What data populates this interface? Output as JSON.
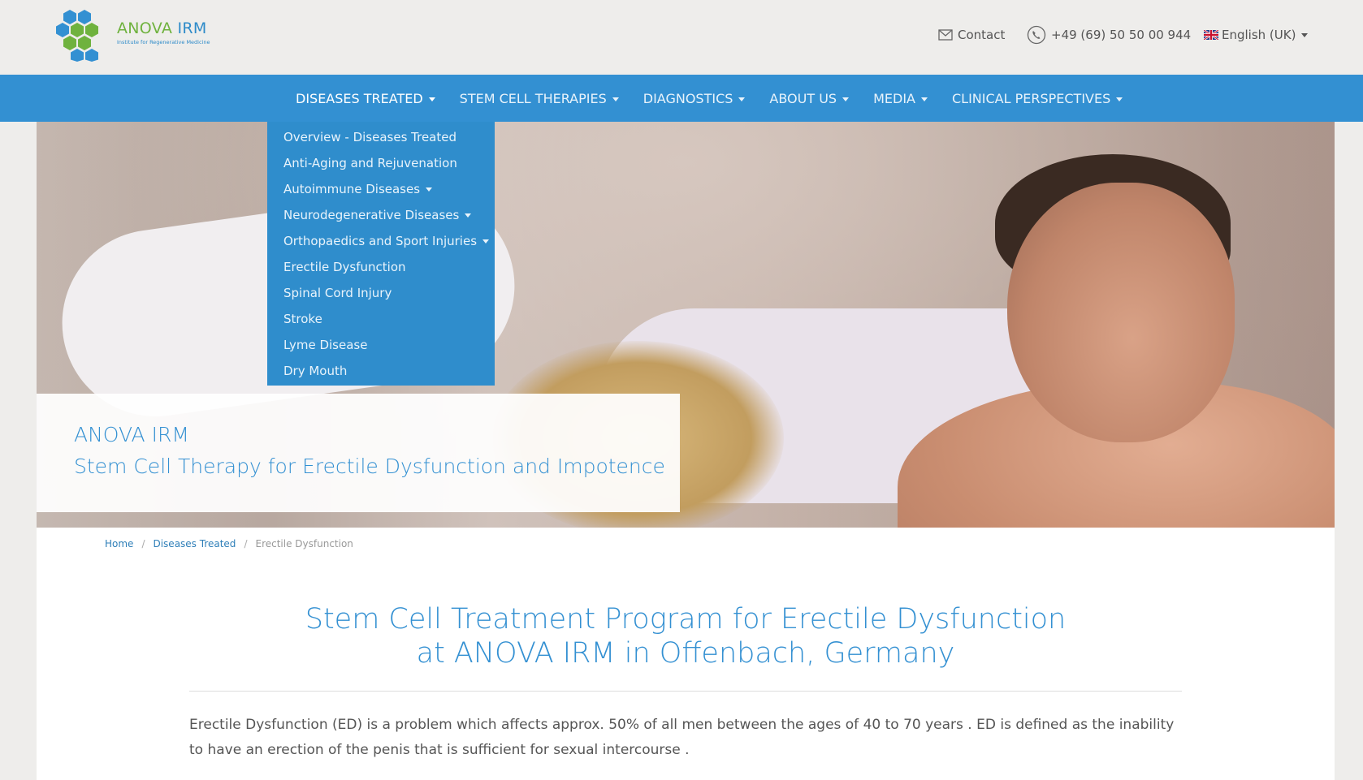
{
  "brand": {
    "name": "ANOVA IRM",
    "name_part1": "ANOVA",
    "name_part2": "IRM",
    "tagline": "Institute for Regenerative Medicine"
  },
  "topbar": {
    "contact_label": "Contact",
    "phone": "+49 (69) 50 50 00 944",
    "language": "English (UK)"
  },
  "nav": {
    "items": [
      {
        "label": "DISEASES TREATED"
      },
      {
        "label": "STEM CELL THERAPIES"
      },
      {
        "label": "DIAGNOSTICS"
      },
      {
        "label": "ABOUT US"
      },
      {
        "label": "MEDIA"
      },
      {
        "label": "CLINICAL PERSPECTIVES"
      }
    ]
  },
  "dropdown": {
    "items": [
      {
        "label": "Overview - Diseases Treated"
      },
      {
        "label": "Anti-Aging and Rejuvenation"
      },
      {
        "label": "Autoimmune Diseases"
      },
      {
        "label": "Neurodegenerative Diseases"
      },
      {
        "label": "Orthopaedics and Sport Injuries"
      },
      {
        "label": "Erectile Dysfunction"
      },
      {
        "label": "Spinal Cord Injury"
      },
      {
        "label": "Stroke"
      },
      {
        "label": "Lyme Disease"
      },
      {
        "label": "Dry Mouth"
      }
    ]
  },
  "hero": {
    "title": "ANOVA IRM",
    "subtitle": "Stem Cell Therapy for Erectile Dysfunction and Impotence"
  },
  "breadcrumb": {
    "home": "Home",
    "section": "Diseases Treated",
    "current": "Erectile Dysfunction"
  },
  "main": {
    "title_line1": "Stem Cell Treatment Program for Erectile Dysfunction",
    "title_line2": "at ANOVA IRM in Offenbach, Germany",
    "intro": "Erectile Dysfunction (ED) is a problem which affects approx. 50% of all men between the ages of 40 to 70 years . ED is defined as the inability to have an erection of the penis that is sufficient for sexual intercourse ."
  },
  "colors": {
    "brand_blue": "#3390d2",
    "brand_green": "#6fb23e",
    "topbar_bg": "#eeedeb"
  }
}
